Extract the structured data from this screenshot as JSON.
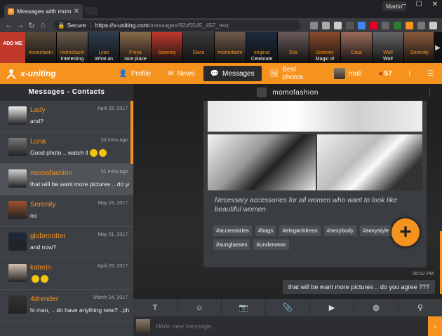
{
  "browser": {
    "tab_title": "Messages with momofas",
    "tab_icon": "X",
    "user": "Martin",
    "secure": "Secure",
    "url_host": "https://x-uniting.com",
    "url_path": "/messages/92#5545_457_text"
  },
  "strip": {
    "add_me": "ADD ME",
    "items": [
      {
        "name": "momofashi",
        "sub": ""
      },
      {
        "name": "momofashi",
        "sub": "Interesting"
      },
      {
        "name": "Lyah",
        "sub": "What an"
      },
      {
        "name": "Freya",
        "sub": "nice place"
      },
      {
        "name": "Serenity",
        "sub": ""
      },
      {
        "name": "Elara",
        "sub": ""
      },
      {
        "name": "momofashi",
        "sub": ""
      },
      {
        "name": "original",
        "sub": "Celebrate"
      },
      {
        "name": "Ella",
        "sub": ""
      },
      {
        "name": "Serenity",
        "sub": "Magic of"
      },
      {
        "name": "Dara",
        "sub": ""
      },
      {
        "name": "Wolf",
        "sub": "Wolf"
      },
      {
        "name": "Serenity",
        "sub": ""
      }
    ]
  },
  "appnav": {
    "logo": "x-uniting",
    "profile": "Profile",
    "news": "News",
    "messages": "Messages",
    "photos": "Best photos",
    "username": "mati",
    "count": "57",
    "info": "i"
  },
  "sidebar": {
    "header": "Messages - Contacts",
    "contacts": [
      {
        "name": "Lady",
        "time": "April 25, 2017",
        "msg": "and?",
        "emoji": 0
      },
      {
        "name": "Luna",
        "time": "30 mins ago",
        "msg": "Good photo .. watch it",
        "emoji": 2
      },
      {
        "name": "momofashion",
        "time": "51 mins ago",
        "msg": "that will be want more pictures .. do yo",
        "emoji": 0
      },
      {
        "name": "Serenity",
        "time": "May 03, 2017",
        "msg": "no",
        "emoji": 0
      },
      {
        "name": "globetrotter",
        "time": "May 01, 2017",
        "msg": "and now?",
        "emoji": 0
      },
      {
        "name": "katerin",
        "time": "April 25, 2017",
        "msg": "",
        "emoji": 2
      },
      {
        "name": "4drender",
        "time": "March 24, 2017",
        "msg": "hi man, .. do have anything new? ..phot",
        "emoji": 0
      }
    ]
  },
  "conversation": {
    "title": "momofashion",
    "caption": "Necessary accessories for all women who want to look like beautiful women",
    "tags": [
      "#accessories",
      "#bags",
      "#elegantdress",
      "#sexybody",
      "#sexystyle",
      "#sunglasses",
      "#underwear"
    ],
    "time": "06:52 PM",
    "bubble": "that will be want more pictures .. do you agree ???",
    "compose_placeholder": "Write new message ..."
  },
  "colors": {
    "accent": "#f6921e",
    "panel": "#3c3f43"
  }
}
